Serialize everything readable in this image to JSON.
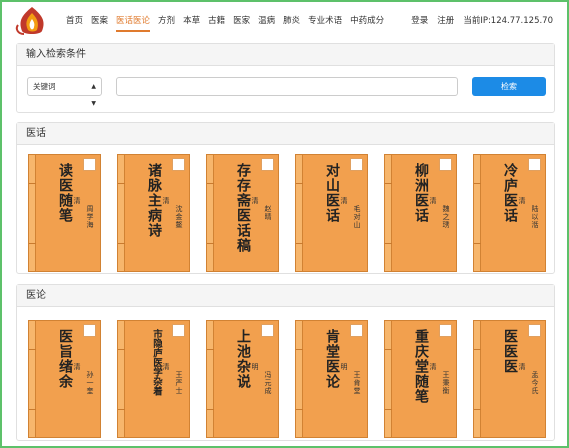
{
  "header": {
    "nav": [
      "首页",
      "医案",
      "医话医论",
      "方剂",
      "本草",
      "古籍",
      "医家",
      "温病",
      "肺炎",
      "专业术语",
      "中药成分"
    ],
    "active_nav": "医话医论",
    "login": "登录",
    "register": "注册",
    "ip_text": "当前IP:124.77.125.70"
  },
  "search": {
    "heading": "输入检索条件",
    "select_value": "关键词",
    "input_value": "",
    "button": "检索"
  },
  "yihua": {
    "heading": "医话",
    "books": [
      {
        "title": "读医随笔",
        "dynasty": "清",
        "author": "周学海"
      },
      {
        "title": "诸脉主病诗",
        "dynasty": "清",
        "author": "沈金鳌"
      },
      {
        "title": "存存斋医话稿",
        "dynasty": "清",
        "author": "赵晴"
      },
      {
        "title": "对山医话",
        "dynasty": "清",
        "author": "毛对山"
      },
      {
        "title": "柳洲医话",
        "dynasty": "清",
        "author": "魏之琇"
      },
      {
        "title": "冷庐医话",
        "dynasty": "清",
        "author": "陆以湉"
      }
    ]
  },
  "yilun": {
    "heading": "医论",
    "books": [
      {
        "title": "医旨绪余",
        "dynasty": "清",
        "author": "孙一奎"
      },
      {
        "title": "市隐庐医学杂着",
        "dynasty": "清",
        "author": "王严士"
      },
      {
        "title": "上池杂说",
        "dynasty": "明",
        "author": "冯元成"
      },
      {
        "title": "肯堂医论",
        "dynasty": "明",
        "author": "王肯堂"
      },
      {
        "title": "重庆堂随笔",
        "dynasty": "清",
        "author": "王秉衡"
      },
      {
        "title": "医医医",
        "dynasty": "清",
        "author": "孟今氏"
      }
    ]
  },
  "colors": {
    "accent": "#e07b2e",
    "button": "#1c8be6",
    "book": "#f2a04e",
    "frame": "#5dc16a"
  }
}
